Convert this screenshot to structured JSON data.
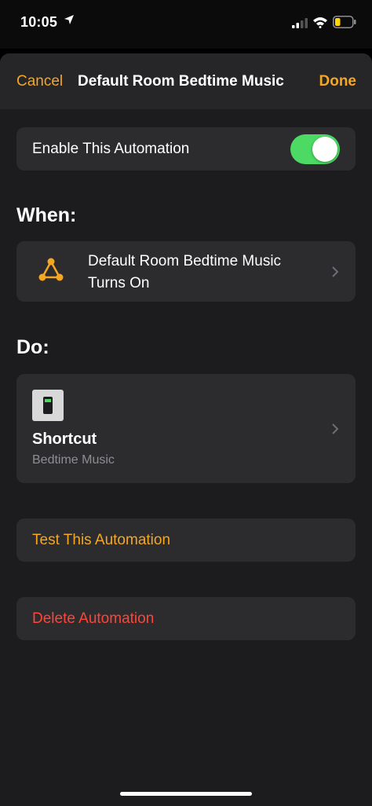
{
  "status_bar": {
    "time": "10:05",
    "icons": [
      "location-arrow-icon",
      "cellular-signal-icon",
      "wifi-icon",
      "battery-icon"
    ],
    "battery_color": "#ffd60a"
  },
  "nav": {
    "cancel_label": "Cancel",
    "title": "Default Room Bedtime Music",
    "done_label": "Done"
  },
  "enable": {
    "label": "Enable This Automation",
    "on": true,
    "toggle_color": "#4cd964"
  },
  "when": {
    "heading": "When:",
    "trigger_line1": "Default Room Bedtime Music",
    "trigger_line2": "Turns On",
    "icon": "scene-trigger-icon"
  },
  "do": {
    "heading": "Do:",
    "action_title": "Shortcut",
    "action_subtitle": "Bedtime Music",
    "icon": "shortcut-switch-icon"
  },
  "actions": {
    "test_label": "Test This Automation",
    "delete_label": "Delete Automation"
  },
  "colors": {
    "accent": "#f5a623",
    "destructive": "#ff453a",
    "background": "#1c1c1e",
    "card": "#2c2c2e"
  }
}
